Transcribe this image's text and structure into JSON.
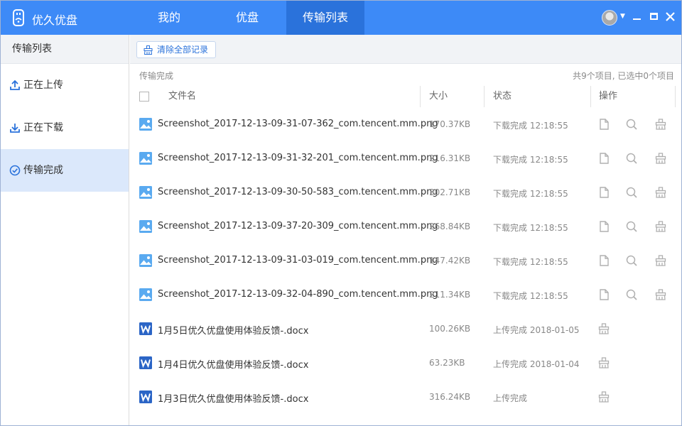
{
  "app": {
    "name": "优久优盘"
  },
  "nav": {
    "tabs": [
      {
        "label": "我的"
      },
      {
        "label": "优盘"
      },
      {
        "label": "传输列表"
      }
    ]
  },
  "icons": {
    "logo": "usb-drive-icon",
    "avatar": "user-avatar",
    "minimize": "minimize-icon",
    "maximize": "maximize-icon",
    "close": "close-icon"
  },
  "colors": {
    "titlebar": "#3d8af7",
    "active_tab": "#2a72db",
    "sidebar_active": "#dbe8fb"
  },
  "sidebar": {
    "title": "传输列表",
    "items": [
      {
        "label": "正在上传"
      },
      {
        "label": "正在下载"
      },
      {
        "label": "传输完成"
      }
    ]
  },
  "toolbar": {
    "clear_label": "清除全部记录"
  },
  "section": {
    "label": "传输完成",
    "count": "共9个项目, 已选中0个项目"
  },
  "table": {
    "headers": {
      "name": "文件名",
      "size": "大小",
      "status": "状态",
      "actions": "操作"
    },
    "rows": [
      {
        "name": "Screenshot_2017-12-13-09-31-07-362_com.tencent.mm.png",
        "size": "170.37KB",
        "status": "下载完成 12:18:55"
      },
      {
        "name": "Screenshot_2017-12-13-09-31-32-201_com.tencent.mm.png",
        "size": "216.31KB",
        "status": "下载完成 12:18:55"
      },
      {
        "name": "Screenshot_2017-12-13-09-30-50-583_com.tencent.mm.png",
        "size": "302.71KB",
        "status": "下载完成 12:18:55"
      },
      {
        "name": "Screenshot_2017-12-13-09-37-20-309_com.tencent.mm.png",
        "size": "268.84KB",
        "status": "下载完成 12:18:55"
      },
      {
        "name": "Screenshot_2017-12-13-09-31-03-019_com.tencent.mm.png",
        "size": "147.42KB",
        "status": "下载完成 12:18:55"
      },
      {
        "name": "Screenshot_2017-12-13-09-32-04-890_com.tencent.mm.png",
        "size": "211.34KB",
        "status": "下载完成 12:18:55"
      },
      {
        "name": "1月5日优久优盘使用体验反馈-.docx",
        "size": "100.26KB",
        "status": "上传完成 2018-01-05"
      },
      {
        "name": "1月4日优久优盘使用体验反馈-.docx",
        "size": "63.23KB",
        "status": "上传完成 2018-01-04"
      },
      {
        "name": "1月3日优久优盘使用体验反馈-.docx",
        "size": "316.24KB",
        "status": "上传完成"
      }
    ]
  }
}
